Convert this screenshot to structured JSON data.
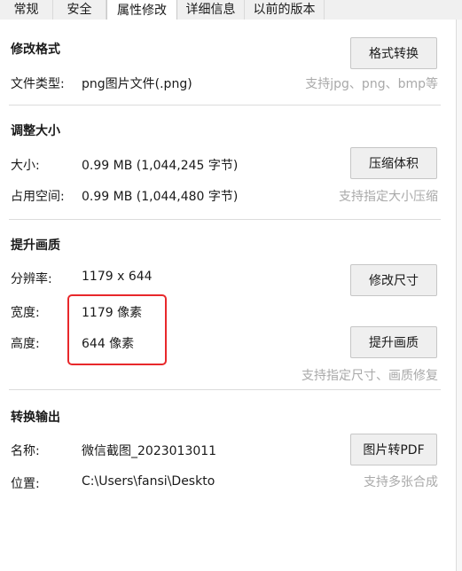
{
  "tabs": [
    "常规",
    "安全",
    "属性修改",
    "详细信息",
    "以前的版本"
  ],
  "active_tab": "属性修改",
  "sections": {
    "format": {
      "title": "修改格式",
      "type_label": "文件类型:",
      "type_value": "png图片文件(.png)",
      "button": "格式转换",
      "hint": "支持jpg、png、bmp等"
    },
    "size": {
      "title": "调整大小",
      "size_label": "大小:",
      "size_value": "0.99 MB (1,044,245 字节)",
      "disk_label": "占用空间:",
      "disk_value": "0.99 MB (1,044,480 字节)",
      "button": "压缩体积",
      "hint": "支持指定大小压缩"
    },
    "quality": {
      "title": "提升画质",
      "resolution_label": "分辨率:",
      "resolution_value": "1179 x 644",
      "width_label": "宽度:",
      "width_value": "1179 像素",
      "height_label": "高度:",
      "height_value": "644 像素",
      "resize_button": "修改尺寸",
      "enhance_button": "提升画质",
      "hint": "支持指定尺寸、画质修复"
    },
    "convert": {
      "title": "转换输出",
      "name_label": "名称:",
      "name_value": "微信截图_2023013011",
      "location_label": "位置:",
      "location_value": "C:\\Users\\fansi\\Deskto",
      "button": "图片转PDF",
      "hint": "支持多张合成"
    }
  },
  "colors": {
    "hint": "#a9a9a9",
    "highlight_box": "#e8282b",
    "button_bg": "#efefef"
  }
}
